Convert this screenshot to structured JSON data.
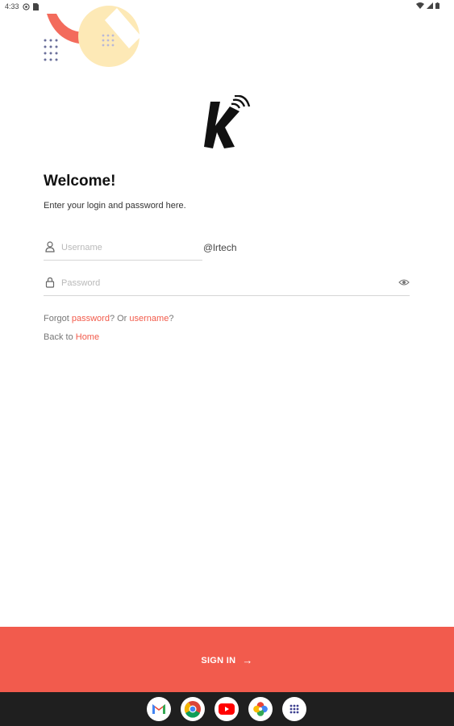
{
  "status_bar": {
    "time": "4:33"
  },
  "welcome": {
    "title": "Welcome!",
    "subtitle": "Enter your login and password here."
  },
  "form": {
    "username": {
      "placeholder": "Username",
      "value": "",
      "suffix": "@lrtech"
    },
    "password": {
      "placeholder": "Password",
      "value": ""
    }
  },
  "links": {
    "forgot_prefix": "Forgot ",
    "password_link": "password",
    "middle": "? Or ",
    "username_link": "username",
    "forgot_suffix": "?",
    "back_prefix": "Back to ",
    "home_link": "Home"
  },
  "signin": {
    "label": "SIGN IN",
    "arrow": "→"
  },
  "colors": {
    "accent": "#f25b4d",
    "deco_yellow": "#fde9b6",
    "taskbar": "#1f1f1f"
  },
  "taskbar": {
    "apps": [
      {
        "icon": "gmail-icon"
      },
      {
        "icon": "chrome-icon"
      },
      {
        "icon": "youtube-icon"
      },
      {
        "icon": "photos-icon"
      },
      {
        "icon": "app-drawer-icon"
      }
    ]
  }
}
